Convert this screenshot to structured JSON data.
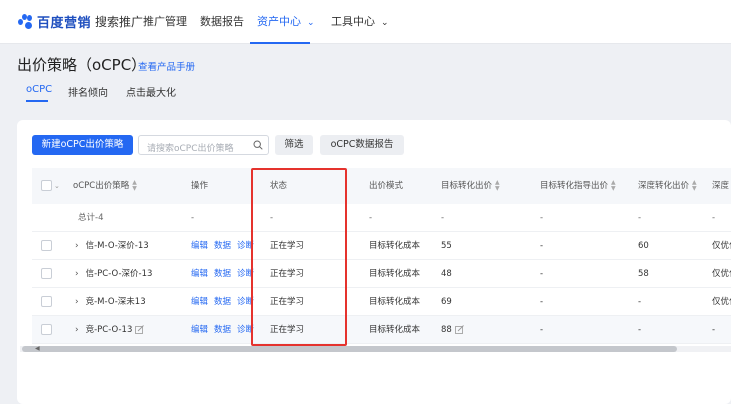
{
  "brand": {
    "name": "百度营销",
    "sub": "搜索推广"
  },
  "nav": [
    {
      "label": "推广管理",
      "active": false,
      "dropdown": false
    },
    {
      "label": "数据报告",
      "active": false,
      "dropdown": false
    },
    {
      "label": "资产中心",
      "active": true,
      "dropdown": true
    },
    {
      "label": "工具中心",
      "active": false,
      "dropdown": true
    }
  ],
  "page": {
    "title": "出价策略（oCPC）",
    "manual_link": "查看产品手册"
  },
  "subtabs": [
    {
      "label": "oCPC",
      "active": true
    },
    {
      "label": "排名倾向",
      "active": false
    },
    {
      "label": "点击最大化",
      "active": false
    }
  ],
  "toolbar": {
    "new_button": "新建oCPC出价策略",
    "search_placeholder": "请搜索oCPC出价策略",
    "filter_button": "筛选",
    "report_button": "oCPC数据报告"
  },
  "table": {
    "columns": [
      "oCPC出价策略",
      "操作",
      "状态",
      "出价模式",
      "目标转化出价",
      "目标转化指导出价",
      "深度转化出价",
      "深度"
    ],
    "total_row": [
      "总计-4",
      "-",
      "-",
      "-",
      "-",
      "-",
      "-",
      "-"
    ],
    "rows": [
      {
        "name": "信-M-O-深价-13",
        "actions": [
          "编辑",
          "数据",
          "诊断"
        ],
        "status": "正在学习",
        "mode": "目标转化成本",
        "target_bid": "55",
        "guide_bid": "-",
        "deep_bid": "60",
        "deep": "仅优化"
      },
      {
        "name": "信-PC-O-深价-13",
        "actions": [
          "编辑",
          "数据",
          "诊断"
        ],
        "status": "正在学习",
        "mode": "目标转化成本",
        "target_bid": "48",
        "guide_bid": "-",
        "deep_bid": "58",
        "deep": "仅优化"
      },
      {
        "name": "竞-M-O-深未13",
        "actions": [
          "编辑",
          "数据",
          "诊断"
        ],
        "status": "正在学习",
        "mode": "目标转化成本",
        "target_bid": "69",
        "guide_bid": "-",
        "deep_bid": "-",
        "deep": "仅优化"
      },
      {
        "name": "竞-PC-O-13",
        "actions": [
          "编辑",
          "数据",
          "诊断"
        ],
        "status": "正在学习",
        "mode": "目标转化成本",
        "target_bid": "88",
        "guide_bid": "-",
        "deep_bid": "-",
        "deep": "-"
      }
    ]
  },
  "colors": {
    "accent": "#2468f2",
    "highlight": "#e5322d"
  }
}
